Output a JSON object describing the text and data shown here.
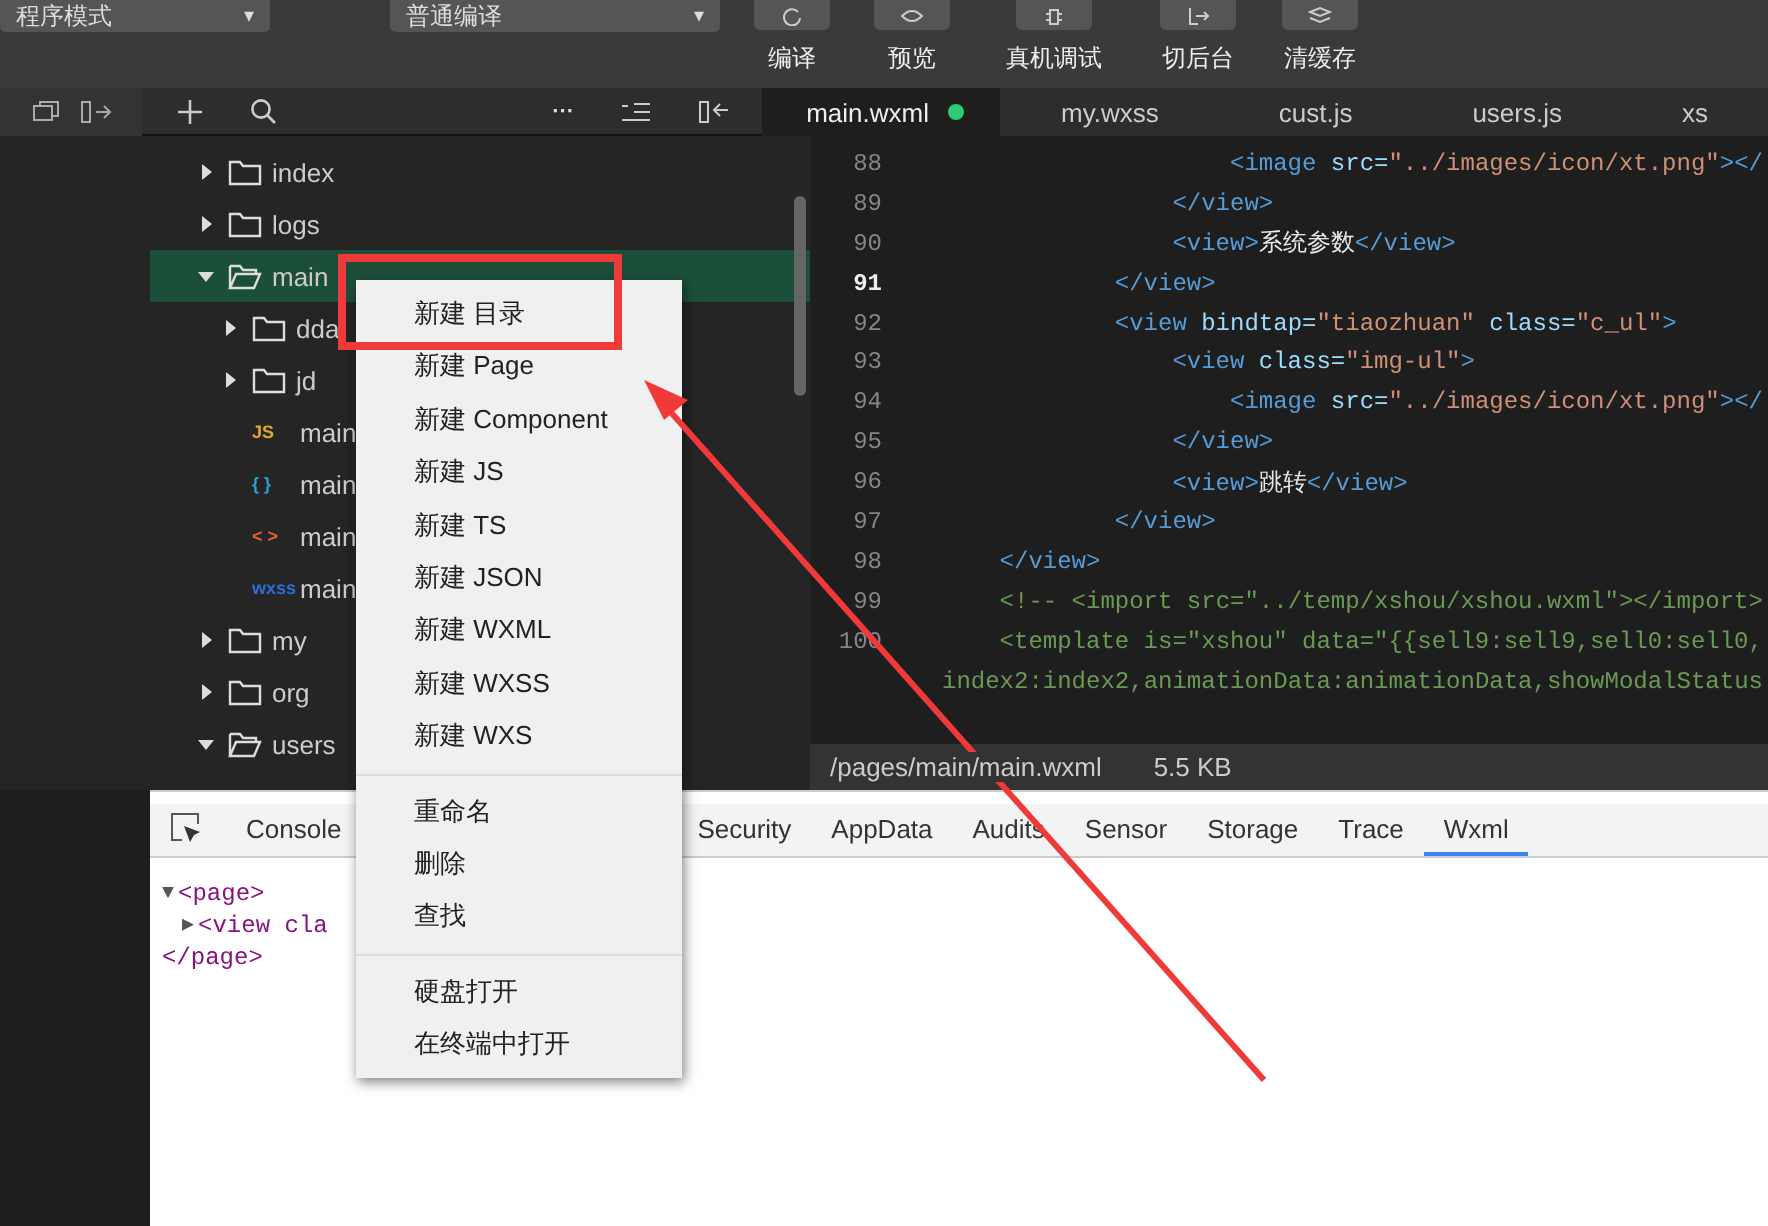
{
  "toolbar": {
    "dropdowns": [
      {
        "label": "程序模式",
        "caret": "▾"
      },
      {
        "label": "普通编译",
        "caret": "▾"
      }
    ],
    "actions": [
      {
        "label": "编译"
      },
      {
        "label": "预览"
      },
      {
        "label": "真机调试"
      },
      {
        "label": "切后台"
      },
      {
        "label": "清缓存"
      }
    ]
  },
  "tree_toolbar": {
    "more": "···"
  },
  "tree": [
    {
      "kind": "folder",
      "name": "index",
      "expanded": false,
      "selected": false
    },
    {
      "kind": "folder",
      "name": "logs",
      "expanded": false,
      "selected": false
    },
    {
      "kind": "folder",
      "name": "main",
      "expanded": true,
      "selected": true,
      "children": [
        {
          "kind": "folder",
          "name": "dda",
          "expanded": false,
          "selected": false
        },
        {
          "kind": "folder",
          "name": "jd",
          "expanded": false,
          "selected": false
        },
        {
          "kind": "file",
          "name": "main",
          "badge": "JS",
          "color": "#e5a823",
          "selected": false
        },
        {
          "kind": "file",
          "name": "main",
          "badge": "{ }",
          "color": "#2a9fd8",
          "selected": false
        },
        {
          "kind": "file",
          "name": "main",
          "badge": "< >",
          "color": "#e0662a",
          "selected": false
        },
        {
          "kind": "file",
          "name": "main",
          "badge": "wxss",
          "color": "#2a6fd8",
          "selected": false
        }
      ]
    },
    {
      "kind": "folder",
      "name": "my",
      "expanded": false,
      "selected": false
    },
    {
      "kind": "folder",
      "name": "org",
      "expanded": false,
      "selected": false
    },
    {
      "kind": "folder",
      "name": "users",
      "expanded": true,
      "selected": false
    }
  ],
  "editor": {
    "tabs": [
      {
        "label": "main.wxml",
        "modified": true,
        "selected": true
      },
      {
        "label": "my.wxss",
        "modified": false,
        "selected": false
      },
      {
        "label": "cust.js",
        "modified": false,
        "selected": false
      },
      {
        "label": "users.js",
        "modified": false,
        "selected": false
      },
      {
        "label": "xs",
        "modified": false,
        "selected": false
      }
    ],
    "lines": [
      {
        "number": "88",
        "current": false,
        "tokens": [
          {
            "kind": "tag",
            "text": "<image "
          },
          {
            "kind": "attr",
            "text": "src="
          },
          {
            "kind": "str",
            "text": "\"../images/icon/xt.png\""
          },
          {
            "kind": "tag",
            "text": "></"
          }
        ]
      },
      {
        "number": "89",
        "current": false,
        "tokens": [
          {
            "kind": "tag",
            "text": "</view>"
          }
        ]
      },
      {
        "number": "90",
        "current": false,
        "tokens": [
          {
            "kind": "tag",
            "text": "<view>"
          },
          {
            "kind": "text",
            "text": "系统参数"
          },
          {
            "kind": "tag",
            "text": "</view>"
          }
        ]
      },
      {
        "number": "91",
        "current": true,
        "tokens": [
          {
            "kind": "tag",
            "text": "</view>"
          }
        ]
      },
      {
        "number": "92",
        "current": false,
        "tokens": [
          {
            "kind": "tag",
            "text": "<view "
          },
          {
            "kind": "attr",
            "text": "bindtap="
          },
          {
            "kind": "str",
            "text": "\"tiaozhuan\""
          },
          {
            "kind": "attr",
            "text": " class="
          },
          {
            "kind": "str",
            "text": "\"c_ul\""
          },
          {
            "kind": "tag",
            "text": ">"
          }
        ]
      },
      {
        "number": "93",
        "current": false,
        "tokens": [
          {
            "kind": "tag",
            "text": "<view "
          },
          {
            "kind": "attr",
            "text": "class="
          },
          {
            "kind": "str",
            "text": "\"img-ul\""
          },
          {
            "kind": "tag",
            "text": ">"
          }
        ]
      },
      {
        "number": "94",
        "current": false,
        "tokens": [
          {
            "kind": "tag",
            "text": "<image "
          },
          {
            "kind": "attr",
            "text": "src="
          },
          {
            "kind": "str",
            "text": "\"../images/icon/xt.png\""
          },
          {
            "kind": "tag",
            "text": "></"
          }
        ]
      },
      {
        "number": "95",
        "current": false,
        "tokens": [
          {
            "kind": "tag",
            "text": "</view>"
          }
        ]
      },
      {
        "number": "96",
        "current": false,
        "tokens": [
          {
            "kind": "tag",
            "text": "<view>"
          },
          {
            "kind": "text",
            "text": "跳转"
          },
          {
            "kind": "tag",
            "text": "</view>"
          }
        ]
      },
      {
        "number": "97",
        "current": false,
        "tokens": [
          {
            "kind": "tag",
            "text": "</view>"
          }
        ]
      },
      {
        "number": "98",
        "current": false,
        "tokens": [
          {
            "kind": "tag",
            "text": "</view>"
          }
        ]
      },
      {
        "number": "99",
        "current": false,
        "tokens": [
          {
            "kind": "comment",
            "text": "<!-- <import src=\"../temp/xshou/xshou.wxml\"></import>"
          }
        ]
      },
      {
        "number": "100",
        "current": false,
        "tokens": [
          {
            "kind": "comment",
            "text": "<template is=\"xshou\" data=\"{{sell9:sell9,sell0:sell0,"
          }
        ]
      },
      {
        "tokens": [
          {
            "kind": "comment",
            "text": "index2:index2,animationData:animationData,showModalStatus"
          }
        ]
      }
    ],
    "status": {
      "path": "/pages/main/main.wxml",
      "size": "5.5 KB"
    }
  },
  "devtools": {
    "tabs": [
      {
        "label": "Console",
        "selected": false
      },
      {
        "label": "Security",
        "selected": false
      },
      {
        "label": "AppData",
        "selected": false
      },
      {
        "label": "Audits",
        "selected": false
      },
      {
        "label": "Sensor",
        "selected": false
      },
      {
        "label": "Storage",
        "selected": false
      },
      {
        "label": "Trace",
        "selected": false
      },
      {
        "label": "Wxml",
        "selected": true
      }
    ],
    "wxml": [
      {
        "toggle": "▼",
        "text": "<page>"
      },
      {
        "toggle": "▶",
        "text": "<view cla"
      },
      {
        "text": "</page>"
      }
    ]
  },
  "context_menu": {
    "groups": [
      [
        "新建 目录",
        "新建 Page",
        "新建 Component",
        "新建 JS",
        "新建 TS",
        "新建 JSON",
        "新建 WXML",
        "新建 WXSS",
        "新建 WXS"
      ],
      [
        "重命名",
        "删除",
        "查找"
      ],
      [
        "硬盘打开",
        "在终端中打开"
      ]
    ]
  }
}
